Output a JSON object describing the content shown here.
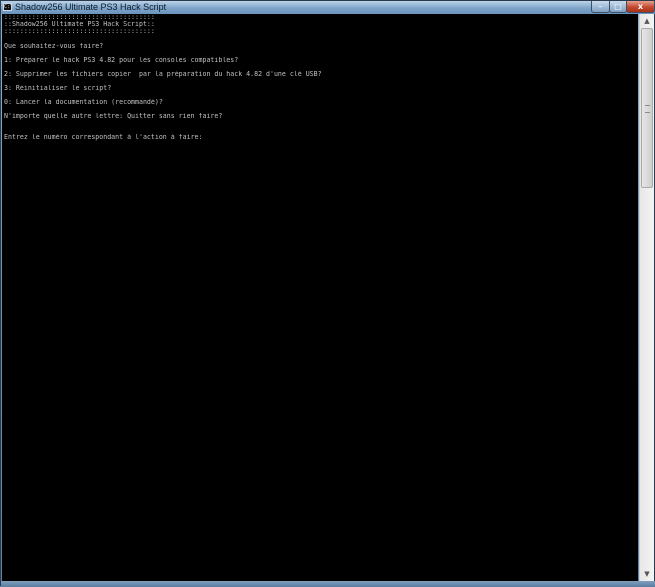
{
  "window": {
    "title": "Shadow256 Ultimate PS3 Hack Script",
    "icon_text": "C:\\",
    "controls": {
      "minimize_icon": "minimize-icon",
      "maximize_icon": "maximize-icon",
      "close_icon": "close-icon",
      "minimize_glyph": "–",
      "maximize_glyph": "□",
      "close_glyph": "x"
    }
  },
  "console": {
    "banner": [
      "::::::::::::::::::::::::::::::::::::::",
      "::Shadow256 Ultimate PS3 Hack Script::",
      "::::::::::::::::::::::::::::::::::::::"
    ],
    "prompt_question": "Que souhaitez-vous faire?",
    "options": [
      "1: Préparer le hack PS3 4.82 pour les consoles compatibles?",
      "2: Supprimer les fichiers copier  par la préparation du hack 4.82 d'une clé USB?",
      "3: Réinitialiser le script?",
      "0: Lancer la documentation (recommandé)?"
    ],
    "other_key": "N'importe quelle autre lettre: Quitter sans rien faire?",
    "input_prompt": "Entrez le numéro correspondant à l'action à faire:"
  },
  "scrollbar": {
    "up_arrow": "▲",
    "down_arrow": "▼"
  },
  "colors": {
    "console_bg": "#000000",
    "console_text": "#c0c0c0",
    "close_button": "#c24a2f"
  }
}
